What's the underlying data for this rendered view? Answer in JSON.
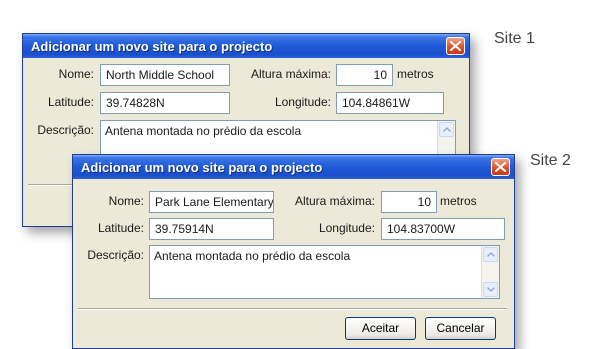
{
  "captions": {
    "site1": "Site 1",
    "site2": "Site 2"
  },
  "dialog1": {
    "title": "Adicionar um novo site para o projecto",
    "name_label": "Nome:",
    "name_value": "North Middle School",
    "max_height_label": "Altura máxima:",
    "max_height_value": "10",
    "unit": "metros",
    "latitude_label": "Latitude:",
    "latitude_value": "39.74828N",
    "longitude_label": "Longitude:",
    "longitude_value": "104.84861W",
    "description_label": "Descrição:",
    "description_value": "Antena montada no prédio da escola"
  },
  "dialog2": {
    "title": "Adicionar um novo site para o projecto",
    "name_label": "Nome:",
    "name_value": "Park Lane Elementary",
    "max_height_label": "Altura máxima:",
    "max_height_value": "10",
    "unit": "metros",
    "latitude_label": "Latitude:",
    "latitude_value": "39.75914N",
    "longitude_label": "Longitude:",
    "longitude_value": "104.83700W",
    "description_label": "Descrição:",
    "description_value": "Antena montada no prédio da escola",
    "accept_label": "Aceitar",
    "cancel_label": "Cancelar"
  },
  "colors": {
    "titlebar": "#1f5ad8",
    "close": "#d9542e",
    "dialog_bg": "#ece9d8"
  },
  "icons": {
    "close": "close-icon",
    "scroll_up": "chevron-up-icon",
    "scroll_down": "chevron-down-icon"
  }
}
